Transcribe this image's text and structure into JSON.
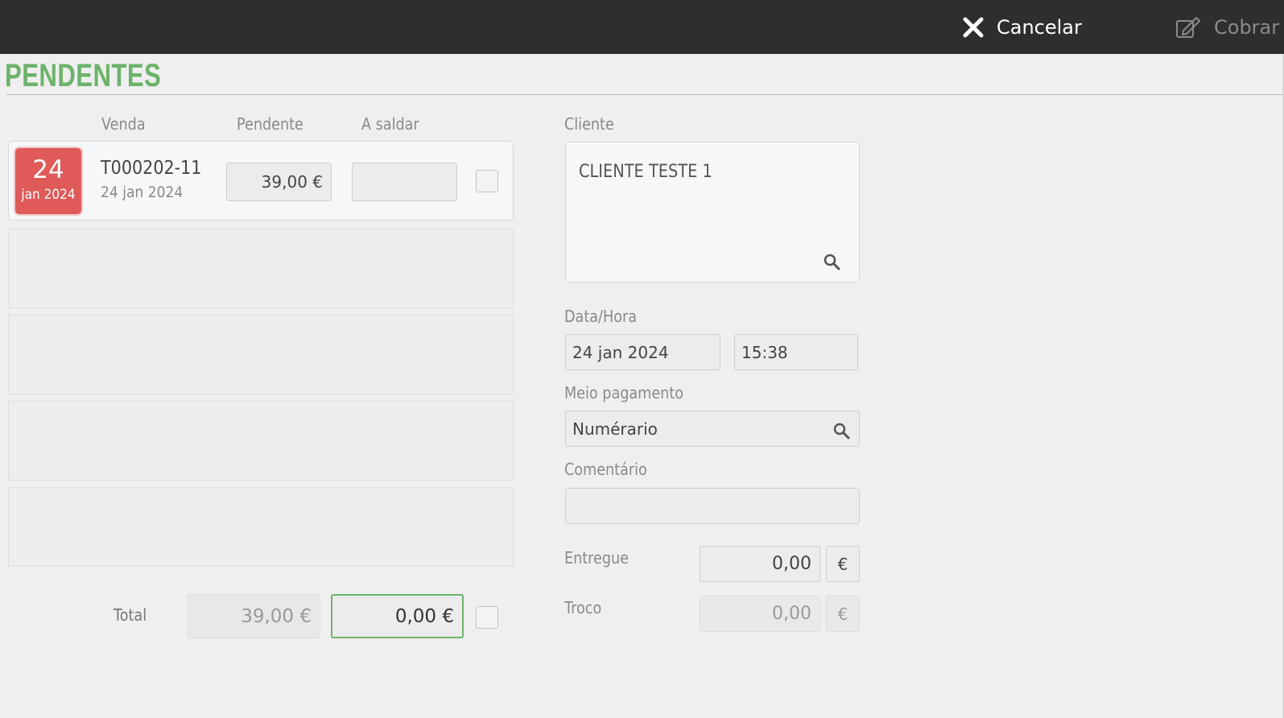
{
  "topbar": {
    "cancel_label": "Cancelar",
    "cobrar_label": "Cobrar",
    "cancel_icon": "close-icon",
    "cobrar_icon": "edit-icon"
  },
  "page": {
    "title": "PENDENTES"
  },
  "table": {
    "headers": {
      "venda": "Venda",
      "pendente": "Pendente",
      "a_saldar": "A saldar"
    },
    "rows": [
      {
        "day": "24",
        "month_year": "jan 2024",
        "sale_id": "T000202-11",
        "sale_date": "24 jan 2024",
        "pendente": "39,00 €",
        "a_saldar": "",
        "checked": false
      }
    ]
  },
  "totals": {
    "label": "Total",
    "pendente": "39,00 €",
    "a_saldar": "0,00 €",
    "checked": false
  },
  "form": {
    "cliente_label": "Cliente",
    "cliente_name": "CLIENTE TESTE 1",
    "datahora_label": "Data/Hora",
    "date": "24 jan 2024",
    "time": "15:38",
    "meio_label": "Meio pagamento",
    "meio_value": "Numérario",
    "comentario_label": "Comentário",
    "comentario_value": "",
    "entregue_label": "Entregue",
    "entregue_value": "0,00",
    "entregue_currency": "€",
    "troco_label": "Troco",
    "troco_value": "0,00",
    "troco_currency": "€"
  },
  "colors": {
    "topbar_bg": "#2e2e2e",
    "title_green": "#6db36b",
    "date_badge_red": "#e05a5a",
    "active_border_green": "#6db36b"
  }
}
